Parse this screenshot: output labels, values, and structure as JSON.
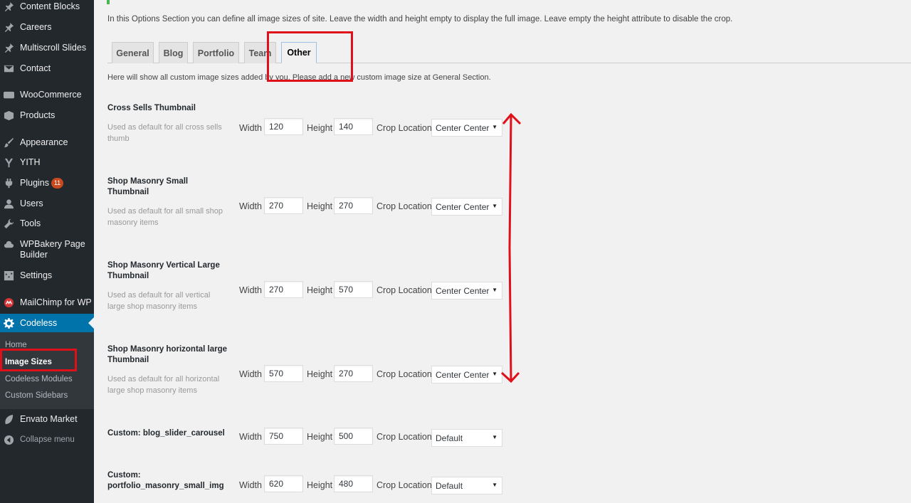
{
  "sidebar": {
    "items": [
      {
        "label": "Content Blocks",
        "icon": "pin-icon"
      },
      {
        "label": "Careers",
        "icon": "pin-icon"
      },
      {
        "label": "Multiscroll Slides",
        "icon": "pin-icon"
      },
      {
        "label": "Contact",
        "icon": "mail-icon"
      },
      {
        "label": "WooCommerce",
        "icon": "woo-icon"
      },
      {
        "label": "Products",
        "icon": "box-icon"
      },
      {
        "label": "Appearance",
        "icon": "brush-icon"
      },
      {
        "label": "YITH",
        "icon": "yith-icon"
      },
      {
        "label": "Plugins",
        "icon": "plug-icon",
        "badge": "11"
      },
      {
        "label": "Users",
        "icon": "user-icon"
      },
      {
        "label": "Tools",
        "icon": "wrench-icon"
      },
      {
        "label": "WPBakery Page Builder",
        "icon": "cloud-icon"
      },
      {
        "label": "Settings",
        "icon": "sliders-icon"
      },
      {
        "label": "MailChimp for WP",
        "icon": "mailchimp-icon"
      },
      {
        "label": "Codeless",
        "icon": "gear-icon"
      },
      {
        "label": "Envato Market",
        "icon": "leaf-icon"
      },
      {
        "label": "Collapse menu",
        "icon": "collapse-icon"
      }
    ],
    "submenu": [
      "Home",
      "Image Sizes",
      "Codeless Modules",
      "Custom Sidebars"
    ]
  },
  "main": {
    "intro": "In this Options Section you can define all image sizes of site. Leave the width and height empty to display the full image. Leave empty the height attribute to disable the crop.",
    "tabs": [
      "General",
      "Blog",
      "Portfolio",
      "Team",
      "Other"
    ],
    "active_tab": "Other",
    "note": "Here will show all custom image sizes added by you. Please add a new custom image size at General Section.",
    "labels": {
      "width": "Width",
      "height": "Height",
      "crop": "Crop Location"
    },
    "rows": [
      {
        "title": "Cross Sells Thumbnail",
        "desc": "Used as default for all cross sells thumb",
        "width": "120",
        "height": "140",
        "crop": "Center Center"
      },
      {
        "title": "Shop Masonry Small Thumbnail",
        "desc": "Used as default for all small shop masonry items",
        "width": "270",
        "height": "270",
        "crop": "Center Center"
      },
      {
        "title": "Shop Masonry Vertical Large Thumbnail",
        "desc": "Used as default for all vertical large shop masonry items",
        "width": "270",
        "height": "570",
        "crop": "Center Center"
      },
      {
        "title": "Shop Masonry horizontal large Thumbnail",
        "desc": "Used as default for all horizontal large shop masonry items",
        "width": "570",
        "height": "270",
        "crop": "Center Center"
      },
      {
        "title": "Custom: blog_slider_carousel",
        "desc": "",
        "width": "750",
        "height": "500",
        "crop": "Default"
      },
      {
        "title": "Custom: portfolio_masonry_small_img",
        "desc": "",
        "width": "620",
        "height": "480",
        "crop": "Default"
      }
    ]
  },
  "colors": {
    "sidebar_bg": "#23282d",
    "active_blue": "#0073aa",
    "annotation_red": "#e0101a",
    "badge": "#ca4a1f"
  }
}
